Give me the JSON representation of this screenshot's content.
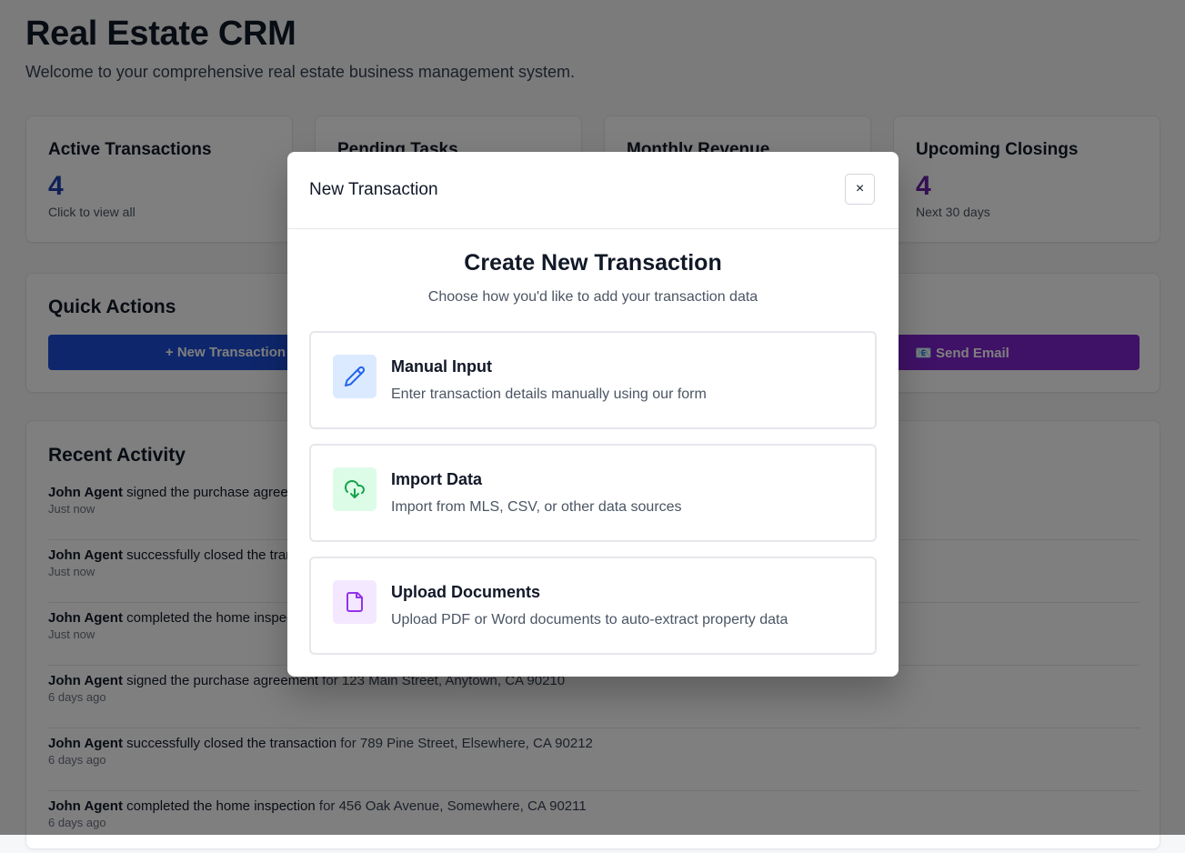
{
  "header": {
    "title": "Real Estate CRM",
    "subtitle": "Welcome to your comprehensive real estate business management system."
  },
  "stats": [
    {
      "label": "Active Transactions",
      "value": "4",
      "hint": "Click to view all",
      "color": "#1e40af"
    },
    {
      "label": "Pending Tasks",
      "value": "",
      "hint": "",
      "color": "#111827"
    },
    {
      "label": "Monthly Revenue",
      "value": "",
      "hint": "",
      "color": "#111827"
    },
    {
      "label": "Upcoming Closings",
      "value": "4",
      "hint": "Next 30 days",
      "color": "#6b21a8"
    }
  ],
  "quick_actions": {
    "title": "Quick Actions",
    "new_transaction": "+ New Transaction",
    "send_email": "📧 Send Email",
    "colors": {
      "primary": "#1d4ed8",
      "purple": "#7e22ce"
    }
  },
  "recent_activity": {
    "title": "Recent Activity",
    "items": [
      {
        "agent": "John Agent",
        "action": "signed the purchase agreement",
        "rest": "",
        "time": "Just now"
      },
      {
        "agent": "John Agent",
        "action": "successfully closed the transaction",
        "rest": "",
        "time": "Just now"
      },
      {
        "agent": "John Agent",
        "action": "completed the home inspection",
        "rest": "",
        "time": "Just now"
      },
      {
        "agent": "John Agent",
        "action": "signed the purchase agreement",
        "rest": " for 123 Main Street, Anytown, CA 90210",
        "time": "6 days ago"
      },
      {
        "agent": "John Agent",
        "action": "successfully closed the transaction",
        "rest": " for 789 Pine Street, Elsewhere, CA 90212",
        "time": "6 days ago"
      },
      {
        "agent": "John Agent",
        "action": "completed the home inspection",
        "rest": " for 456 Oak Avenue, Somewhere, CA 90211",
        "time": "6 days ago"
      }
    ]
  },
  "modal": {
    "title": "New Transaction",
    "close_icon": "×",
    "heading": "Create New Transaction",
    "description": "Choose how you'd like to add your transaction data",
    "options": [
      {
        "title": "Manual Input",
        "description": "Enter transaction details manually using our form",
        "icon": "pencil-icon",
        "icon_bg": "#dbeafe",
        "icon_color": "#2563eb"
      },
      {
        "title": "Import Data",
        "description": "Import from MLS, CSV, or other data sources",
        "icon": "cloud-download-icon",
        "icon_bg": "#dcfce7",
        "icon_color": "#16a34a"
      },
      {
        "title": "Upload Documents",
        "description": "Upload PDF or Word documents to auto-extract property data",
        "icon": "file-icon",
        "icon_bg": "#f3e8ff",
        "icon_color": "#9333ea"
      }
    ]
  }
}
